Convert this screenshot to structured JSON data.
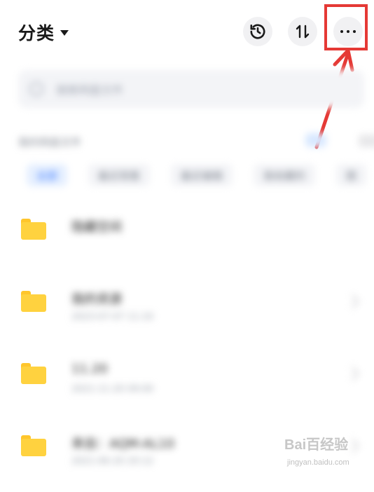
{
  "header": {
    "title": "分类",
    "more_label": "···"
  },
  "search": {
    "placeholder": "搜索网盘文件"
  },
  "path": {
    "text": "我的网盘文件"
  },
  "filters": [
    {
      "label": "全部",
      "active": true
    },
    {
      "label": "最近观看"
    },
    {
      "label": "最近编辑"
    },
    {
      "label": "我收藏的"
    },
    {
      "label": "图"
    }
  ],
  "files": [
    {
      "name": "隐藏空间",
      "sub": ""
    },
    {
      "name": "我的资源",
      "sub": "2023-07-07 11:10"
    },
    {
      "name": "11.20",
      "sub": "2021-11-20 09:00"
    },
    {
      "name": "来自：AQM-AL10",
      "sub": "2021-06-20 20:12"
    }
  ],
  "watermark": {
    "brand": "Bai百经验",
    "url": "jingyan.baidu.com"
  },
  "colors": {
    "highlight": "#e53935",
    "folder": "#ffd23f",
    "accent": "#3d7bff"
  }
}
